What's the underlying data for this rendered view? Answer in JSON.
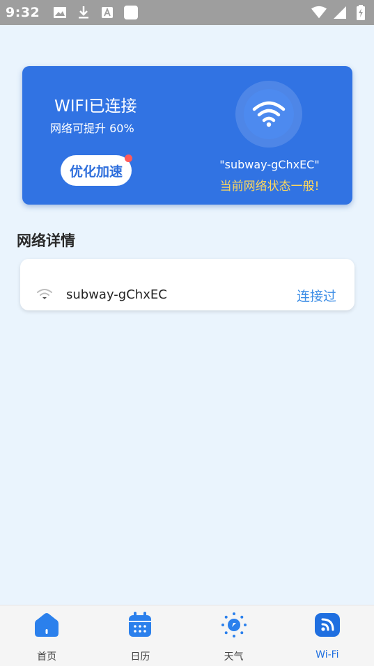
{
  "status_bar": {
    "time": "9:32",
    "left_icons": [
      "image-icon",
      "download-icon",
      "text-icon",
      "blank-square-icon"
    ],
    "right_icons": [
      "wifi-signal-icon",
      "cell-signal-icon",
      "battery-charging-icon"
    ]
  },
  "wifi_card": {
    "title": "WIFI已连接",
    "subtitle": "网络可提升 60%",
    "boost_label": "优化加速",
    "ssid": "\"subway-gChxEC\"",
    "status_text": "当前网络状态一般!"
  },
  "section": {
    "title": "网络详情"
  },
  "networks": [
    {
      "ssid": "subway-gChxEC",
      "state": "连接过"
    }
  ],
  "bottom_nav": [
    {
      "label": "首页",
      "icon": "home-icon",
      "active": false
    },
    {
      "label": "日历",
      "icon": "calendar-icon",
      "active": false
    },
    {
      "label": "天气",
      "icon": "weather-icon",
      "active": false
    },
    {
      "label": "Wi-Fi",
      "icon": "wifi-nav-icon",
      "active": true
    }
  ],
  "colors": {
    "background": "#eaf4fd",
    "card": "#3173e3",
    "accent": "#1f6fe0",
    "status_warning": "#ffd85c",
    "status_bar": "#9e9e9e"
  }
}
